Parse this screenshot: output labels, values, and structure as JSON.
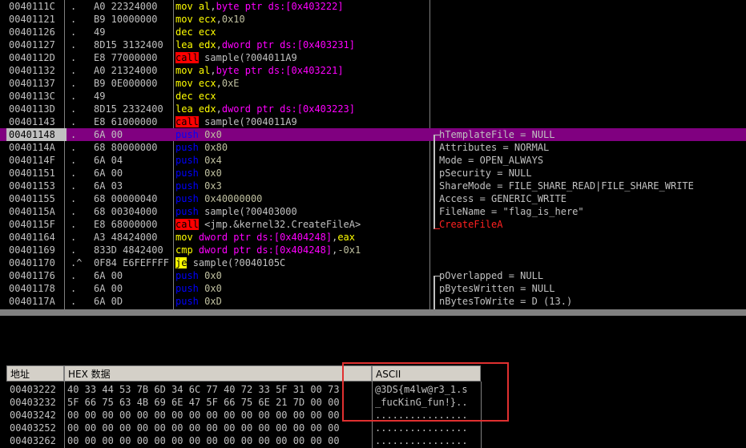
{
  "disasm": [
    {
      "addr": "0040111C",
      "mark": ".",
      "hex": "A0 22324000",
      "mn": "mov",
      "mc": "m-mov",
      "ops": [
        [
          "reg",
          "al"
        ],
        [
          "sym",
          ","
        ],
        [
          "ptr",
          "byte ptr ds:[0x403222]"
        ]
      ],
      "comment": ""
    },
    {
      "addr": "00401121",
      "mark": ".",
      "hex": "B9 10000000",
      "mn": "mov",
      "mc": "m-mov",
      "ops": [
        [
          "reg",
          "ecx"
        ],
        [
          "sym",
          ","
        ],
        [
          "num",
          "0x10"
        ]
      ],
      "comment": ""
    },
    {
      "addr": "00401126",
      "mark": ".",
      "hex": "49",
      "mn": "dec",
      "mc": "m-dec",
      "ops": [
        [
          "reg",
          "ecx"
        ]
      ],
      "comment": ""
    },
    {
      "addr": "00401127",
      "mark": ".",
      "hex": "8D15 3132400",
      "mn": "lea",
      "mc": "m-lea",
      "ops": [
        [
          "reg",
          "edx"
        ],
        [
          "sym",
          ","
        ],
        [
          "ptr",
          "dword ptr ds:[0x403231]"
        ]
      ],
      "comment": ""
    },
    {
      "addr": "0040112D",
      "mark": ".",
      "hex": "E8 77000000",
      "mn": "call",
      "mc": "m-call",
      "ops": [
        [
          "sym",
          "sample(?004011A9"
        ]
      ],
      "comment": ""
    },
    {
      "addr": "00401132",
      "mark": ".",
      "hex": "A0 21324000",
      "mn": "mov",
      "mc": "m-mov",
      "ops": [
        [
          "reg",
          "al"
        ],
        [
          "sym",
          ","
        ],
        [
          "ptr",
          "byte ptr ds:[0x403221]"
        ]
      ],
      "comment": ""
    },
    {
      "addr": "00401137",
      "mark": ".",
      "hex": "B9 0E000000",
      "mn": "mov",
      "mc": "m-mov",
      "ops": [
        [
          "reg",
          "ecx"
        ],
        [
          "sym",
          ","
        ],
        [
          "num",
          "0xE"
        ]
      ],
      "comment": ""
    },
    {
      "addr": "0040113C",
      "mark": ".",
      "hex": "49",
      "mn": "dec",
      "mc": "m-dec",
      "ops": [
        [
          "reg",
          "ecx"
        ]
      ],
      "comment": ""
    },
    {
      "addr": "0040113D",
      "mark": ".",
      "hex": "8D15 2332400",
      "mn": "lea",
      "mc": "m-lea",
      "ops": [
        [
          "reg",
          "edx"
        ],
        [
          "sym",
          ","
        ],
        [
          "ptr",
          "dword ptr ds:[0x403223]"
        ]
      ],
      "comment": ""
    },
    {
      "addr": "00401143",
      "mark": ".",
      "hex": "E8 61000000",
      "mn": "call",
      "mc": "m-call",
      "ops": [
        [
          "sym",
          "sample(?004011A9"
        ]
      ],
      "comment": ""
    },
    {
      "addr": "00401148",
      "mark": ".",
      "hex": "6A 00",
      "mn": "push",
      "mc": "m-push",
      "ops": [
        [
          "num",
          "0x0"
        ]
      ],
      "comment": "hTemplateFile = NULL",
      "selected": true
    },
    {
      "addr": "0040114A",
      "mark": ".",
      "hex": "68 80000000",
      "mn": "push",
      "mc": "m-push",
      "ops": [
        [
          "num",
          "0x80"
        ]
      ],
      "comment": "Attributes = NORMAL"
    },
    {
      "addr": "0040114F",
      "mark": ".",
      "hex": "6A 04",
      "mn": "push",
      "mc": "m-push",
      "ops": [
        [
          "num",
          "0x4"
        ]
      ],
      "comment": "Mode = OPEN_ALWAYS"
    },
    {
      "addr": "00401151",
      "mark": ".",
      "hex": "6A 00",
      "mn": "push",
      "mc": "m-push",
      "ops": [
        [
          "num",
          "0x0"
        ]
      ],
      "comment": "pSecurity = NULL"
    },
    {
      "addr": "00401153",
      "mark": ".",
      "hex": "6A 03",
      "mn": "push",
      "mc": "m-push",
      "ops": [
        [
          "num",
          "0x3"
        ]
      ],
      "comment": "ShareMode = FILE_SHARE_READ|FILE_SHARE_WRITE"
    },
    {
      "addr": "00401155",
      "mark": ".",
      "hex": "68 00000040",
      "mn": "push",
      "mc": "m-push",
      "ops": [
        [
          "num",
          "0x40000000"
        ]
      ],
      "comment": "Access = GENERIC_WRITE"
    },
    {
      "addr": "0040115A",
      "mark": ".",
      "hex": "68 00304000",
      "mn": "push",
      "mc": "m-push",
      "ops": [
        [
          "sym",
          "sample(?00403000"
        ]
      ],
      "comment": "FileName = \"flag_is_here\""
    },
    {
      "addr": "0040115F",
      "mark": ".",
      "hex": "E8 68000000",
      "mn": "call",
      "mc": "m-call",
      "ops": [
        [
          "sym",
          "<jmp.&kernel32.CreateFileA>"
        ]
      ],
      "comment": "CreateFileA",
      "commentRed": true
    },
    {
      "addr": "00401164",
      "mark": ".",
      "hex": "A3 48424000",
      "mn": "mov",
      "mc": "m-mov",
      "ops": [
        [
          "ptr",
          "dword ptr ds:[0x404248]"
        ],
        [
          "sym",
          ","
        ],
        [
          "reg",
          "eax"
        ]
      ],
      "comment": ""
    },
    {
      "addr": "00401169",
      "mark": ".",
      "hex": "833D 4842400",
      "mn": "cmp",
      "mc": "m-cmp",
      "ops": [
        [
          "ptr",
          "dword ptr ds:[0x404248]"
        ],
        [
          "sym",
          ","
        ],
        [
          "num",
          "-0x1"
        ]
      ],
      "comment": ""
    },
    {
      "addr": "00401170",
      "mark": ".^",
      "hex": "0F84 E6FEFFFF",
      "mn": "je",
      "mc": "m-je",
      "ops": [
        [
          "sym",
          "sample(?0040105C"
        ]
      ],
      "comment": ""
    },
    {
      "addr": "00401176",
      "mark": ".",
      "hex": "6A 00",
      "mn": "push",
      "mc": "m-push",
      "ops": [
        [
          "num",
          "0x0"
        ]
      ],
      "comment": "pOverlapped = NULL"
    },
    {
      "addr": "00401178",
      "mark": ".",
      "hex": "6A 00",
      "mn": "push",
      "mc": "m-push",
      "ops": [
        [
          "num",
          "0x0"
        ]
      ],
      "comment": "pBytesWritten = NULL"
    },
    {
      "addr": "0040117A",
      "mark": ".",
      "hex": "6A 0D",
      "mn": "push",
      "mc": "m-push",
      "ops": [
        [
          "num",
          "0xD"
        ]
      ],
      "comment": "nBytesToWrite = D (13.)"
    }
  ],
  "dump": {
    "headers": {
      "addr": "地址",
      "hex": "HEX 数据",
      "ascii": "ASCII"
    },
    "rows": [
      {
        "addr": "00403222",
        "hex": "40 33 44 53 7B 6D 34 6C 77 40 72 33 5F 31 00 73",
        "ascii": "@3DS{m4lw@r3_1.s"
      },
      {
        "addr": "00403232",
        "hex": "5F 66 75 63 4B 69 6E 47 5F 66 75 6E 21 7D 00 00",
        "ascii": "_fucKinG_fun!}.."
      },
      {
        "addr": "00403242",
        "hex": "00 00 00 00 00 00 00 00 00 00 00 00 00 00 00 00",
        "ascii": "................"
      },
      {
        "addr": "00403252",
        "hex": "00 00 00 00 00 00 00 00 00 00 00 00 00 00 00 00",
        "ascii": "................"
      },
      {
        "addr": "00403262",
        "hex": "00 00 00 00 00 00 00 00 00 00 00 00 00 00 00 00",
        "ascii": "................"
      }
    ]
  }
}
